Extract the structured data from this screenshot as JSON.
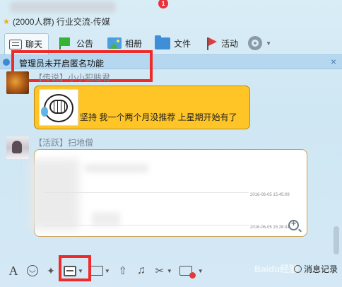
{
  "window": {
    "group_title": "(2000人群) 行业交流-传媒"
  },
  "tabs": [
    {
      "label": "聊天",
      "icon": "chat-icon",
      "active": true
    },
    {
      "label": "公告",
      "icon": "announcement-icon"
    },
    {
      "label": "相册",
      "icon": "album-icon"
    },
    {
      "label": "文件",
      "icon": "file-icon",
      "badge": "1"
    },
    {
      "label": "活动",
      "icon": "activity-flag-icon"
    }
  ],
  "notice": {
    "text": "管理员未开启匿名功能",
    "close": "×"
  },
  "messages": [
    {
      "sender": "【传说】小小犯贱君",
      "text": "坚持  我一个两个月没推荐   上星期开始有了",
      "bubble_color": "#ffc526"
    },
    {
      "sender": "【活跃】扫地僧",
      "timestamps": [
        "2016-06-05 15:45:09",
        "2016-06-05 15:26:41"
      ]
    }
  ],
  "toolbar": {
    "font_label": "A",
    "history_label": "消息记录",
    "watermark": "Baidu经验"
  },
  "colors": {
    "highlight_box": "#ee2a2a",
    "background": "#d4e9f5",
    "notice_bar": "#b5d7ef"
  }
}
